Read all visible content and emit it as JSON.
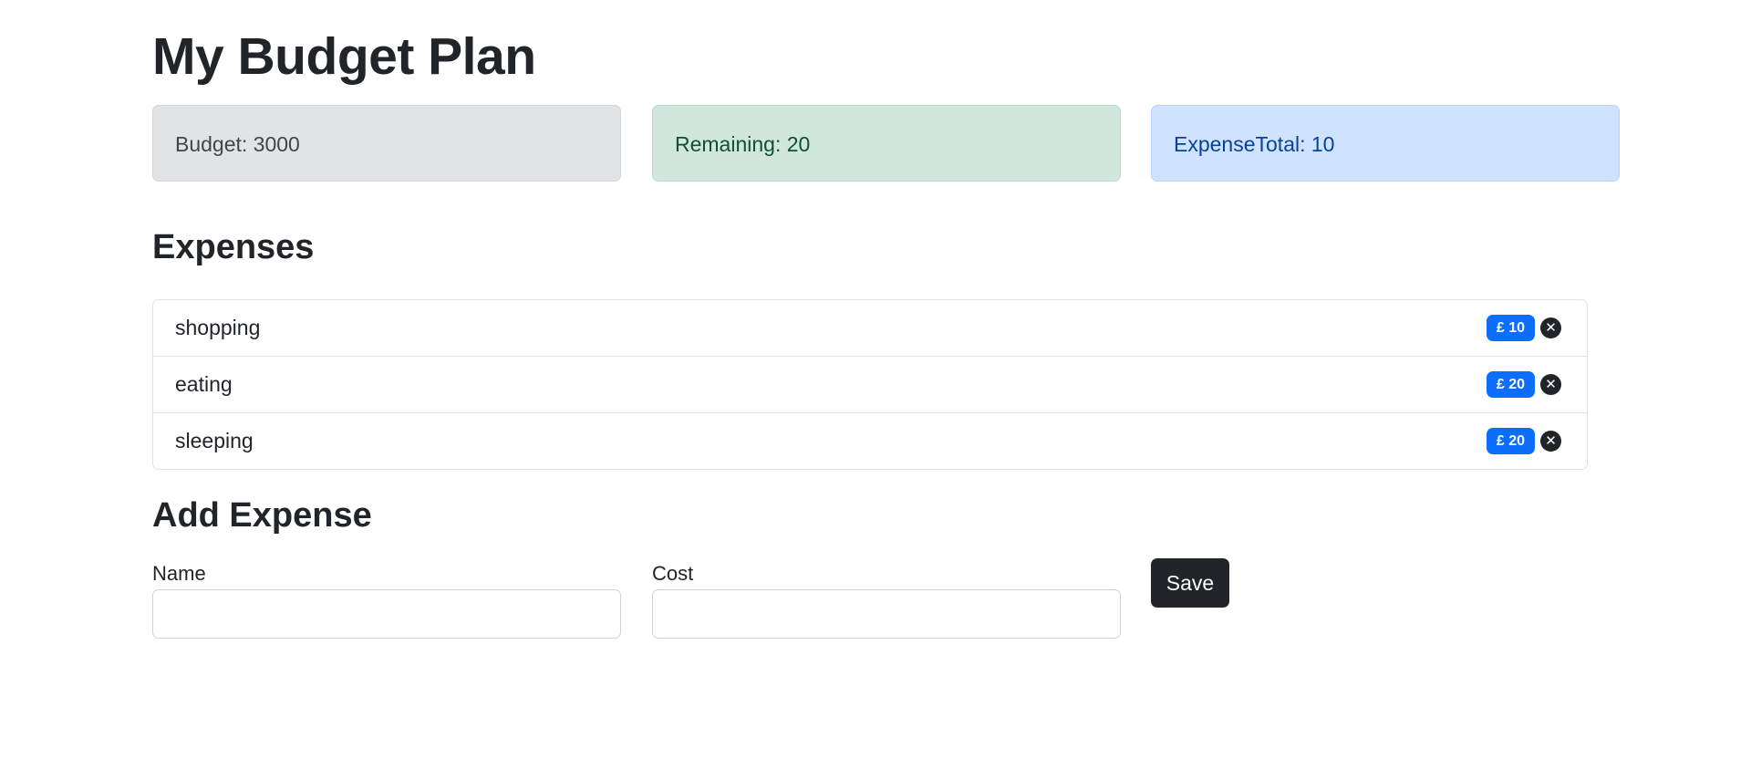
{
  "page": {
    "title": "My Budget Plan"
  },
  "summary": {
    "budget": "Budget: 3000",
    "remaining": "Remaining: 20",
    "expense_total": "ExpenseTotal: 10"
  },
  "expenses": {
    "title": "Expenses",
    "items": [
      {
        "name": "shopping",
        "cost": "£ 10"
      },
      {
        "name": "eating",
        "cost": "£ 20"
      },
      {
        "name": "sleeping",
        "cost": "£ 20"
      }
    ],
    "delete_glyph": "✕"
  },
  "add_expense": {
    "title": "Add Expense",
    "name_label": "Name",
    "name_value": "",
    "cost_label": "Cost",
    "cost_value": "",
    "save_label": "Save"
  },
  "colors": {
    "badge": "#0d6efd",
    "save_button": "#212529",
    "alert_secondary": "#e2e3e5",
    "alert_success": "#d1e7dd",
    "alert_primary": "#cfe2ff"
  }
}
